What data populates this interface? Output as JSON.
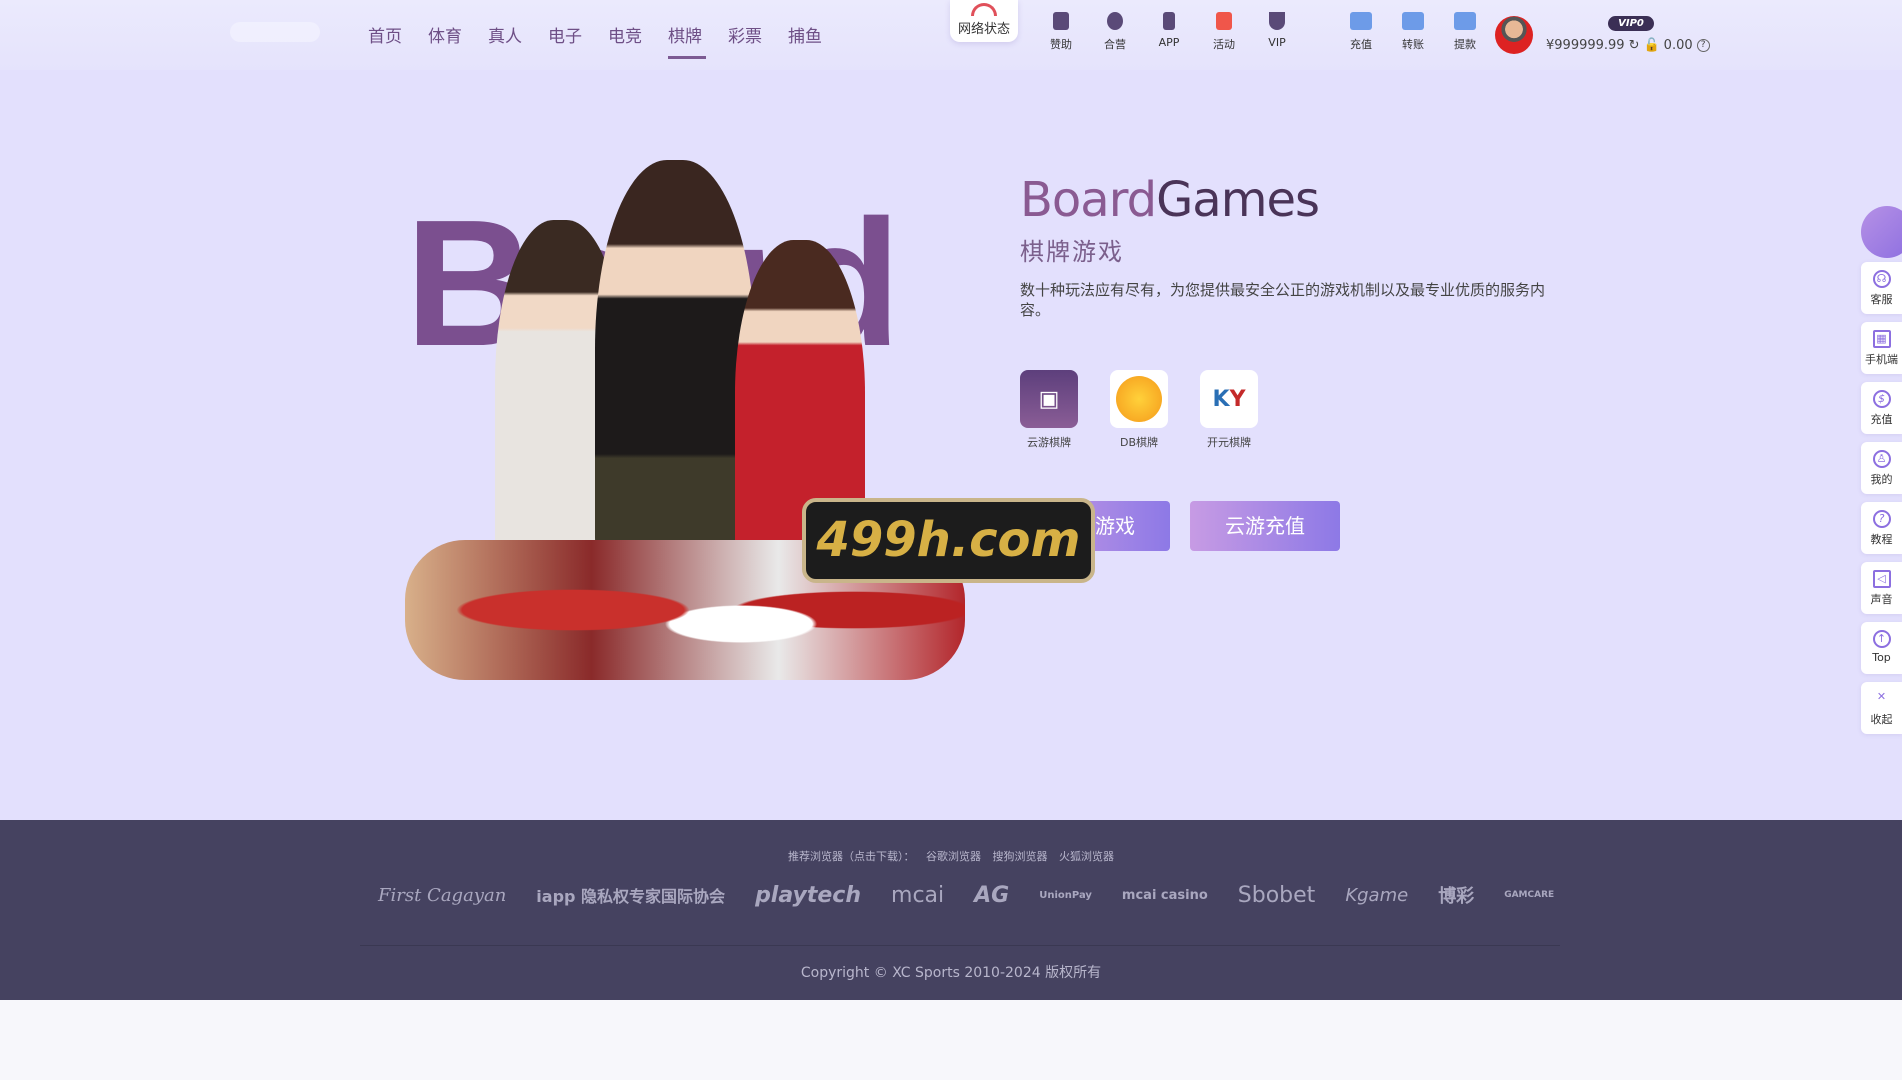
{
  "nav": {
    "items": [
      {
        "label": "首页"
      },
      {
        "label": "体育"
      },
      {
        "label": "真人"
      },
      {
        "label": "电子"
      },
      {
        "label": "电竞"
      },
      {
        "label": "棋牌",
        "active": true
      },
      {
        "label": "彩票"
      },
      {
        "label": "捕鱼"
      }
    ]
  },
  "header": {
    "network_status": "网络状态",
    "quick": [
      {
        "label": "赞助",
        "icon": "bookmark-icon"
      },
      {
        "label": "合营",
        "icon": "handshake-icon"
      },
      {
        "label": "APP",
        "icon": "phone-icon"
      },
      {
        "label": "活动",
        "icon": "gift-icon"
      },
      {
        "label": "VIP",
        "icon": "diamond-icon"
      }
    ],
    "wallet": [
      {
        "label": "充值",
        "icon": "deposit-icon"
      },
      {
        "label": "转账",
        "icon": "transfer-icon"
      },
      {
        "label": "提款",
        "icon": "withdraw-icon"
      }
    ],
    "vip_badge": "VIP0",
    "balance": "¥999999.99",
    "locked_balance": "0.00"
  },
  "hero": {
    "big_word": "Board",
    "badge": "499h.com"
  },
  "content": {
    "title_a": "Board",
    "title_b": "Games",
    "subtitle": "棋牌游戏",
    "description": "数十种玩法应有尽有，为您提供最安全公正的游戏机制以及最专业优质的服务内容。",
    "games": [
      {
        "label": "云游棋牌",
        "color": "#6b4a86"
      },
      {
        "label": "DB棋牌",
        "color": "#f5a623"
      },
      {
        "label": "开元棋牌",
        "color": "#2a6fb5"
      }
    ],
    "enter_button": "进入游戏",
    "recharge_button": "云游充值"
  },
  "sidebar": [
    {
      "label": "客服",
      "icon": "headset-icon"
    },
    {
      "label": "手机端",
      "icon": "qrcode-icon"
    },
    {
      "label": "充值",
      "icon": "money-icon"
    },
    {
      "label": "我的",
      "icon": "user-icon"
    },
    {
      "label": "教程",
      "icon": "help-icon"
    },
    {
      "label": "声音",
      "icon": "speaker-icon"
    },
    {
      "label": "Top",
      "icon": "arrow-up-icon"
    },
    {
      "label": "收起",
      "icon": "collapse-icon"
    }
  ],
  "footer": {
    "browser_prompt": "推荐浏览器（点击下载）：",
    "browsers": [
      "谷歌浏览器",
      "搜狗浏览器",
      "火狐浏览器"
    ],
    "partners": [
      "First Cagayan",
      "iapp 隐私权专家国际协会",
      "playtech",
      "mcai",
      "AG",
      "UnionPay",
      "mcai casino",
      "Sbobet",
      "Kgame",
      "博彩",
      "GAMCARE"
    ],
    "copyright": "Copyright © XC Sports 2010-2024 版权所有"
  }
}
